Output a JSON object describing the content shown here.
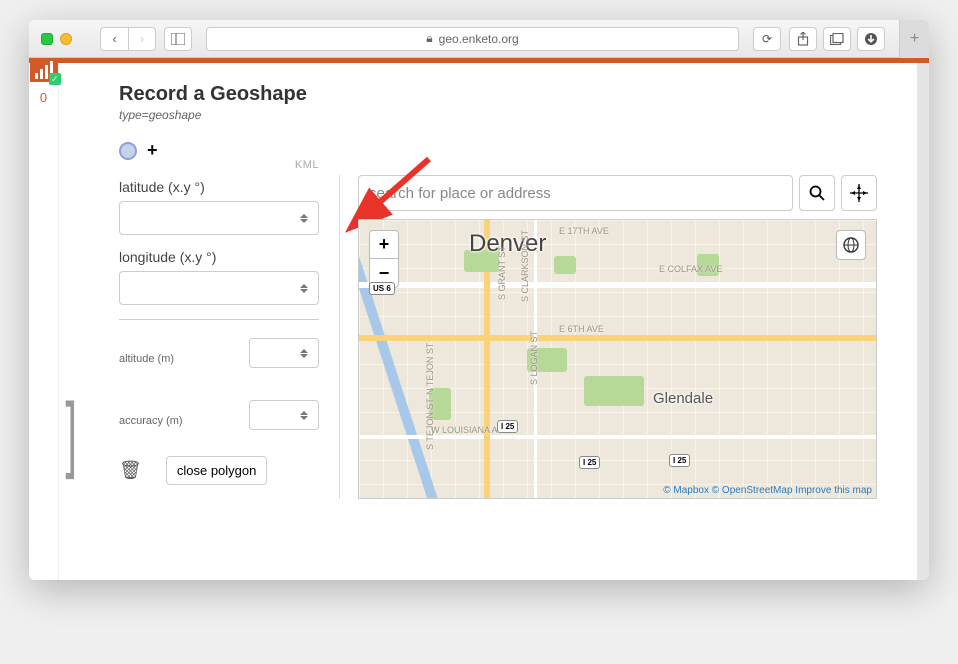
{
  "browser": {
    "url_host": "geo.enketo.org"
  },
  "sidebar": {
    "count": "0"
  },
  "header": {
    "title": "Record a Geoshape",
    "subtitle": "type=geoshape"
  },
  "points": {
    "add_symbol": "+"
  },
  "form": {
    "kml_label": "KML",
    "latitude_label": "latitude (x.y °)",
    "longitude_label": "longitude (x.y °)",
    "altitude_label": "altitude (m)",
    "accuracy_label": "accuracy (m)",
    "close_polygon_label": "close polygon"
  },
  "map": {
    "search_placeholder": "search for place or address",
    "zoom_in": "+",
    "zoom_out": "−",
    "labels": {
      "city": "Denver",
      "suburb": "Glendale",
      "e17th": "E 17TH AVE",
      "colfax": "E COLFAX AVE",
      "e6th": "E 6TH AVE",
      "logan": "S LOGAN ST",
      "clarkson": "S CLARKSON ST",
      "grant": "S GRANT ST",
      "ntejon": "N TEJON ST",
      "stejon": "S TEJON ST",
      "louisiana": "W LOUISIANA AVE",
      "us6": "US 6",
      "i25a": "I 25",
      "i25b": "I 25",
      "i25c": "I 25"
    },
    "attribution": {
      "mapbox": "© Mapbox",
      "osm": "© OpenStreetMap",
      "improve": "Improve this map"
    }
  }
}
